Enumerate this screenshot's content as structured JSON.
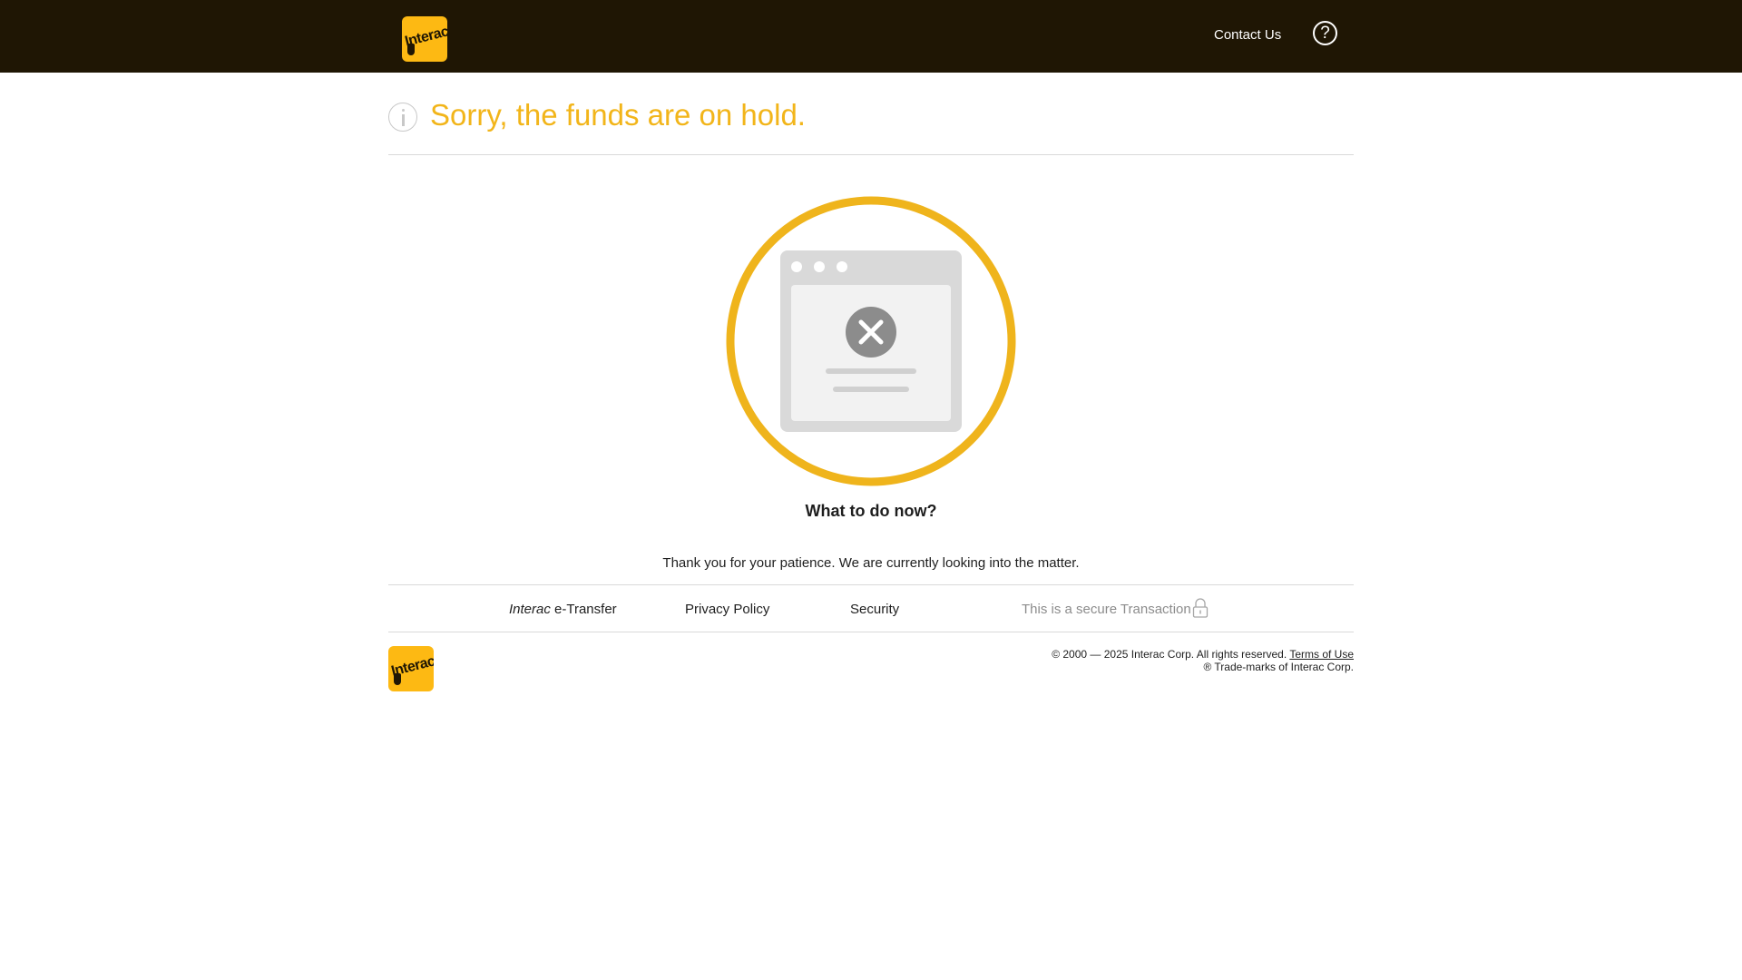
{
  "header": {
    "brand": "Interac",
    "contact_label": "Contact Us",
    "help_glyph": "?",
    "help_icon": "question-circle-icon"
  },
  "status": {
    "icon": "info-icon",
    "title": "Sorry, the funds are on hold."
  },
  "illustration": {
    "icon": "browser-error-icon",
    "ring_color": "#EFB41C"
  },
  "content": {
    "heading": "What to do now?",
    "message": "Thank you for your patience. We are currently looking into the matter."
  },
  "footer_nav": {
    "etransfer_brand": "Interac",
    "etransfer_suffix": " e-Transfer",
    "privacy": "Privacy Policy",
    "security": "Security",
    "secure_text": "This is a secure Transaction",
    "secure_icon": "lock-icon"
  },
  "footer": {
    "brand": "Interac",
    "copyright": "© 2000 — 2025 Interac Corp. All rights reserved.",
    "terms": "Terms of Use",
    "trademark": "® Trade-marks of Interac Corp."
  },
  "colors": {
    "topbar": "#1F1604",
    "accent": "#F2B51A",
    "logo": "#FDB913"
  }
}
